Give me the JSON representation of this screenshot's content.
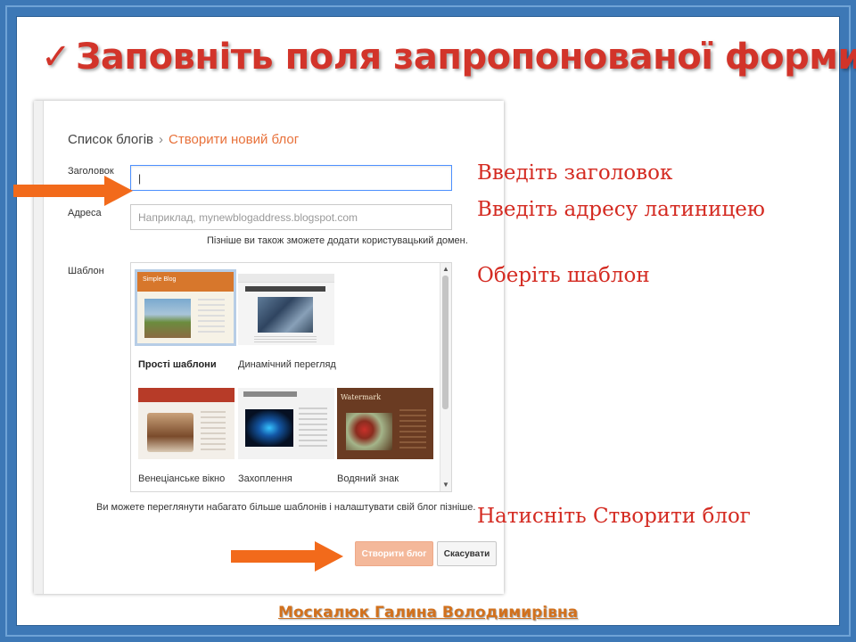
{
  "slide": {
    "title": "Заповніть поля запропонованої форми",
    "check_glyph": "✓",
    "footer": "Москалюк Галина Володимирівна",
    "colors": {
      "frame": "#3d78b6",
      "title": "#d2342a",
      "instructions": "#d42b22",
      "arrow": "#f26a1b",
      "footer": "#d2711d"
    }
  },
  "instructions": {
    "title": "Введіть заголовок",
    "address": "Введіть адресу латиницею",
    "template": "Оберіть шаблон",
    "create": "Натисніть Створити блог"
  },
  "form": {
    "breadcrumb_root": "Список блогів",
    "breadcrumb_sep": "›",
    "breadcrumb_current": "Створити новий блог",
    "title_label": "Заголовок",
    "title_value": "|",
    "address_label": "Адреса",
    "address_placeholder": "Наприклад, mynewblogaddress.blogspot.com",
    "domain_hint": "Пізніше ви також зможете додати користувацький домен.",
    "template_label": "Шаблон",
    "templates": [
      {
        "name": "Прості шаблони",
        "preview_title": "Simple Blog",
        "selected": true
      },
      {
        "name": "Динамічний перегляд",
        "selected": false
      },
      {
        "name": "Венеціанське вікно",
        "selected": false
      },
      {
        "name": "Захоплення",
        "selected": false
      },
      {
        "name": "Водяний знак",
        "preview_title": "Watermark",
        "selected": false
      }
    ],
    "more_templates_hint": "Ви можете переглянути набагато більше шаблонів і налаштувати свій блог пізніше.",
    "create_button": "Створити блог",
    "cancel_button": "Скасувати"
  }
}
